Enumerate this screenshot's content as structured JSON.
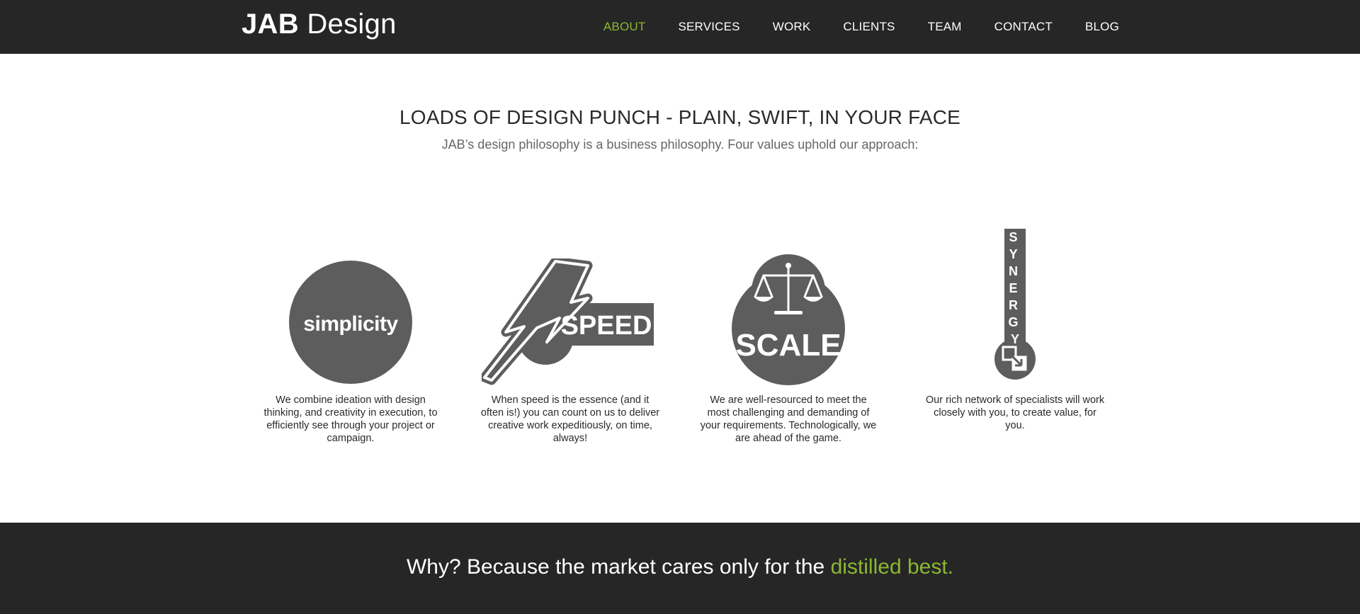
{
  "header": {
    "logo_bold": "JAB",
    "logo_regular": "Design",
    "nav": [
      {
        "label": "ABOUT",
        "active": true
      },
      {
        "label": "SERVICES",
        "active": false
      },
      {
        "label": "WORK",
        "active": false
      },
      {
        "label": "CLIENTS",
        "active": false
      },
      {
        "label": "TEAM",
        "active": false
      },
      {
        "label": "CONTACT",
        "active": false
      },
      {
        "label": "BLOG",
        "active": false
      }
    ]
  },
  "intro": {
    "title": "LOADS OF DESIGN PUNCH - PLAIN, SWIFT, IN YOUR FACE",
    "subtitle": "JAB’s design philosophy is a business philosophy. Four values uphold our approach:"
  },
  "values": [
    {
      "badge_text": "simplicity",
      "icon": "simplicity-circle-icon",
      "description": "We combine ideation with design thinking, and creativity in execution, to efficiently see through your project or campaign."
    },
    {
      "badge_text": "SPEED",
      "icon": "lightning-bolt-icon",
      "description": "When speed is the essence (and it often is!) you can count on us to deliver creative work expeditiously, on time, always!"
    },
    {
      "badge_text": "SCALE",
      "icon": "balance-scale-icon",
      "description": "We are well-resourced to meet the most challenging and demanding of your requirements. Technologically, we are ahead of the game."
    },
    {
      "badge_text": "SYNERGY",
      "icon": "synergy-arrows-icon",
      "description": "Our rich network of specialists will work closely with you, to create value, for you."
    }
  ],
  "footer": {
    "lead": "Why? Because the market cares only for the ",
    "accent": "distilled best."
  },
  "colors": {
    "header_bg": "#262626",
    "accent_green": "#8ab833",
    "icon_gray": "#5d5d5d",
    "text_dark": "#2a2a2a",
    "text_muted": "#666666"
  }
}
